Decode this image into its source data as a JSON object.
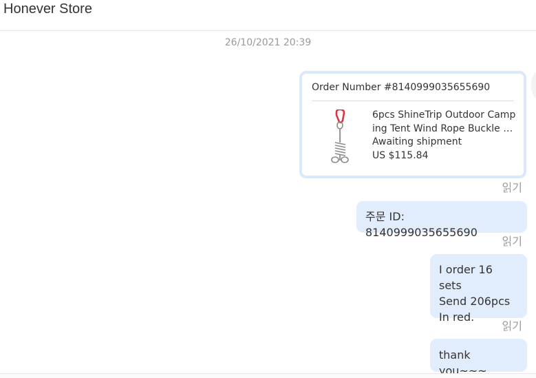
{
  "header": {
    "store_name": "Honever Store"
  },
  "chat": {
    "timestamp": "26/10/2021 20:39",
    "order_card": {
      "order_number": "Order Number #8140999035655690",
      "product_title": "6pcs ShineTrip Outdoor Camping Tent Wind Rope Buckle Hook Stainless Steel",
      "status": "Awaiting shipment",
      "price": "US $115.84",
      "thumb_icon": "tent-stake-hook-icon"
    },
    "read_label_1": "읽기",
    "message_order_id": "주문 ID: 8140999035655690",
    "read_label_2": "읽기",
    "message_order_note": "I order 16 sets\nSend 206pcs\nIn red.",
    "read_label_3": "읽기",
    "message_thanks": "thank you~~~"
  },
  "colors": {
    "bubble": "#e1edfc",
    "card_border": "#dbe8fb",
    "read_label": "#9a9a9a",
    "timestamp": "#999999"
  }
}
